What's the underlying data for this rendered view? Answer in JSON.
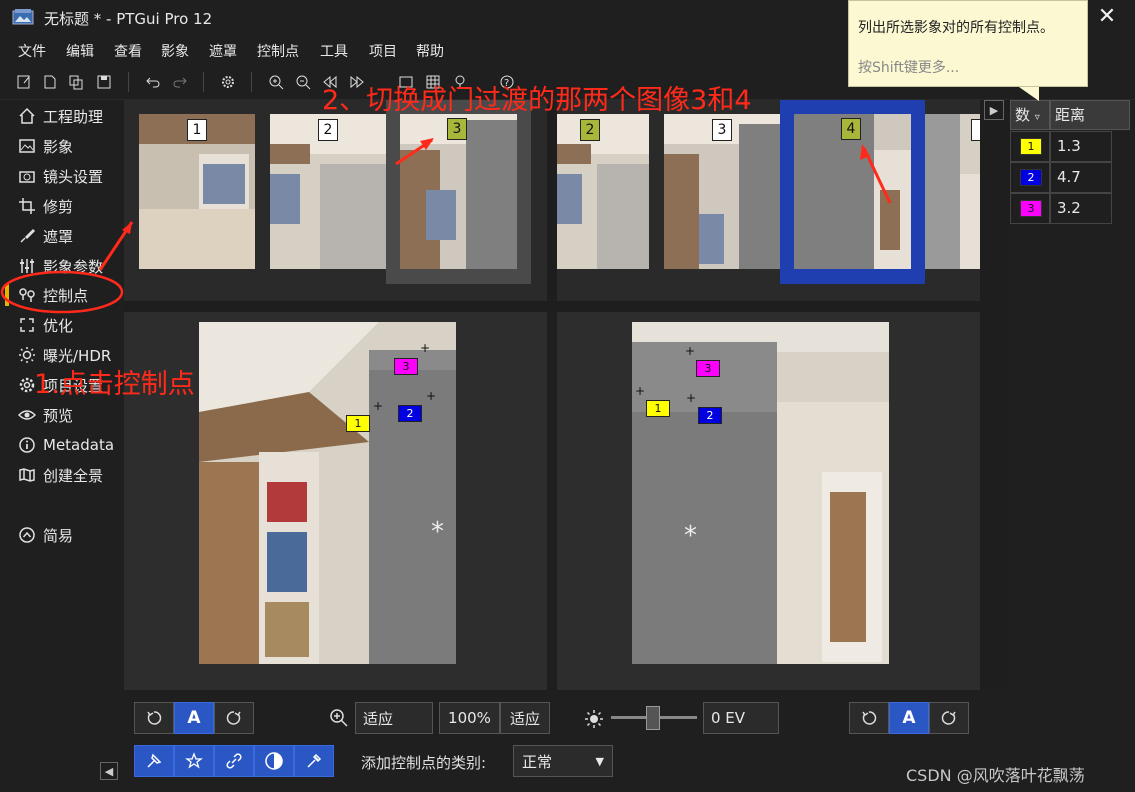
{
  "window": {
    "title": "无标题 * - PTGui Pro 12"
  },
  "menu": [
    "文件",
    "编辑",
    "查看",
    "影象",
    "遮罩",
    "控制点",
    "工具",
    "项目",
    "帮助"
  ],
  "sidebar": {
    "items": [
      {
        "label": "工程助理",
        "icon": "home-icon"
      },
      {
        "label": "影象",
        "icon": "image-icon"
      },
      {
        "label": "镜头设置",
        "icon": "camera-icon"
      },
      {
        "label": "修剪",
        "icon": "crop-icon"
      },
      {
        "label": "遮罩",
        "icon": "brush-icon"
      },
      {
        "label": "影象参数",
        "icon": "sliders-icon"
      },
      {
        "label": "控制点",
        "icon": "pin-icon",
        "active": true
      },
      {
        "label": "优化",
        "icon": "optimize-icon"
      },
      {
        "label": "曝光/HDR",
        "icon": "sun-icon"
      },
      {
        "label": "项目设置",
        "icon": "gear-icon"
      },
      {
        "label": "预览",
        "icon": "eye-icon"
      },
      {
        "label": "Metadata",
        "icon": "info-icon"
      },
      {
        "label": "创建全景",
        "icon": "panorama-icon"
      }
    ],
    "simple_label": "简易"
  },
  "thumbs_left": [
    "1",
    "2",
    "3"
  ],
  "thumbs_right": [
    "2",
    "3",
    "4"
  ],
  "left_view": {
    "cp": [
      {
        "id": "1",
        "color": "#ffff00"
      },
      {
        "id": "2",
        "color": "#0000e0"
      },
      {
        "id": "3",
        "color": "#ff00ff"
      }
    ]
  },
  "right_view": {
    "cp": [
      {
        "id": "1",
        "color": "#ffff00"
      },
      {
        "id": "2",
        "color": "#0000e0"
      },
      {
        "id": "3",
        "color": "#ff00ff"
      }
    ]
  },
  "bottom": {
    "zoom_value": "适应",
    "zoom_100": "100%",
    "zoom_fit": "适应",
    "ev_value": "0 EV",
    "cp_type_label": "添加控制点的类别:",
    "cp_type_value": "正常"
  },
  "cp_table": {
    "col_num": "数",
    "col_dist": "距离",
    "rows": [
      {
        "id": "1",
        "color": "#ffff00",
        "dist": "1.3"
      },
      {
        "id": "2",
        "color": "#0000e0",
        "dist": "4.7"
      },
      {
        "id": "3",
        "color": "#ff00ff",
        "dist": "3.2"
      }
    ]
  },
  "tooltip": {
    "line1": "列出所选影象对的所有控制点。",
    "line2": "按Shift键更多..."
  },
  "annotations": {
    "step1": "1.点击控制点",
    "step2": "2、切换成门过渡的那两个图像3和4"
  },
  "watermark": "CSDN @风吹落叶花飘荡"
}
